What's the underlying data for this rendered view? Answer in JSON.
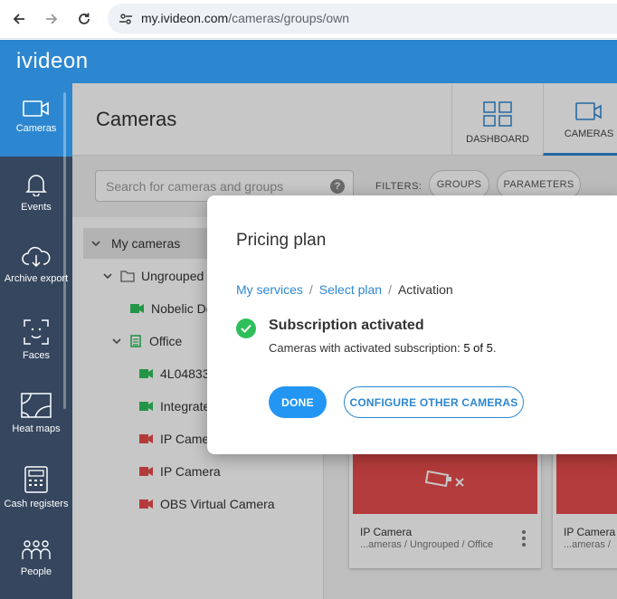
{
  "browser": {
    "url_domain": "my.ivideon.com",
    "url_path": "/cameras/groups/own"
  },
  "app": {
    "logo": "ivideon"
  },
  "sidebar": {
    "items": [
      {
        "label": "Cameras",
        "icon": "camera-icon",
        "active": true
      },
      {
        "label": "Events",
        "icon": "bell-icon"
      },
      {
        "label": "Archive export",
        "icon": "cloud-download-icon"
      },
      {
        "label": "Faces",
        "icon": "face-scan-icon"
      },
      {
        "label": "Heat maps",
        "icon": "heat-map-icon"
      },
      {
        "label": "Cash registers",
        "icon": "cash-register-icon"
      },
      {
        "label": "People",
        "icon": "people-icon"
      }
    ]
  },
  "main": {
    "title": "Cameras",
    "view_tabs": [
      {
        "label": "DASHBOARD",
        "icon": "dashboard-grid-icon"
      },
      {
        "label": "CAMERAS",
        "icon": "camera-icon",
        "active": true
      }
    ],
    "search_placeholder": "Search for cameras and groups",
    "filters_label": "FILTERS:",
    "filter_chips": [
      "GROUPS",
      "PARAMETERS"
    ],
    "tree": [
      {
        "label": "My cameras"
      },
      {
        "label": "Ungrouped"
      },
      {
        "label": "Nobelic Do"
      },
      {
        "label": "Office"
      },
      {
        "label": "4L04833"
      },
      {
        "label": "Integrate"
      },
      {
        "label": "IP Came"
      },
      {
        "label": "IP Camera"
      },
      {
        "label": "OBS Virtual Camera"
      }
    ],
    "cards": [
      {
        "name": "IP Camera",
        "path": "...ameras / Ungrouped / Office"
      },
      {
        "name": "IP Camera",
        "path": "...ameras /"
      }
    ]
  },
  "modal": {
    "title": "Pricing plan",
    "breadcrumb": [
      "My services",
      "Select plan",
      "Activation"
    ],
    "status_title": "Subscription activated",
    "status_text": "Cameras with activated subscription: ",
    "status_count": "5 of 5",
    "status_end": ".",
    "done_label": "DONE",
    "configure_label": "CONFIGURE OTHER CAMERAS"
  },
  "colors": {
    "brand_blue": "#2d87d0",
    "sidebar_bg": "#35465e",
    "camera_online": "#2fbf5a",
    "camera_offline": "#e74c4c"
  }
}
